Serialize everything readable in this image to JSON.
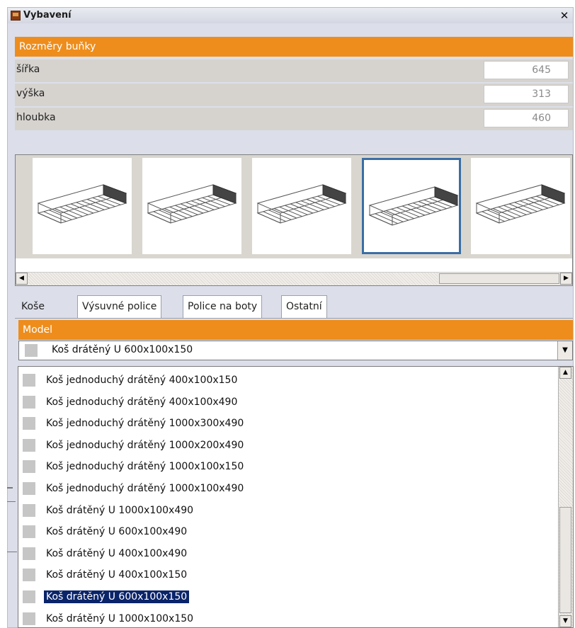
{
  "window": {
    "title": "Vybavení",
    "close_glyph": "✕"
  },
  "dimensions": {
    "header": "Rozměry buňky",
    "rows": [
      {
        "label": "šířka",
        "value": "645"
      },
      {
        "label": "výška",
        "value": "313"
      },
      {
        "label": "hloubka",
        "value": "460"
      }
    ]
  },
  "gallery": {
    "selected_index": 3,
    "thumbnails": [
      "wire-basket-1",
      "wire-basket-2",
      "wire-basket-3",
      "wire-basket-4",
      "wire-basket-5"
    ]
  },
  "tabs": [
    "Koše",
    "Výsuvné police",
    "Police na boty",
    "Ostatní"
  ],
  "model": {
    "header": "Model",
    "selected": "Koš drátěný U 600x100x150",
    "options": [
      "Koš jednoduchý drátěný 400x100x150",
      "Koš jednoduchý drátěný 400x100x490",
      "Koš jednoduchý drátěný 1000x300x490",
      "Koš jednoduchý drátěný 1000x200x490",
      "Koš jednoduchý drátěný 1000x100x150",
      "Koš jednoduchý drátěný 1000x100x490",
      "Koš drátěný U 1000x100x490",
      "Koš drátěný U 600x100x490",
      "Koš drátěný U 400x100x490",
      "Koš drátěný U 400x100x150",
      "Koš drátěný U 600x100x150",
      "Koš drátěný U 1000x100x150"
    ],
    "highlighted_index": 10
  },
  "colors": {
    "accent": "#ee8d1c",
    "selection": "#0a246a",
    "thumb_border": "#3a6ea5"
  }
}
